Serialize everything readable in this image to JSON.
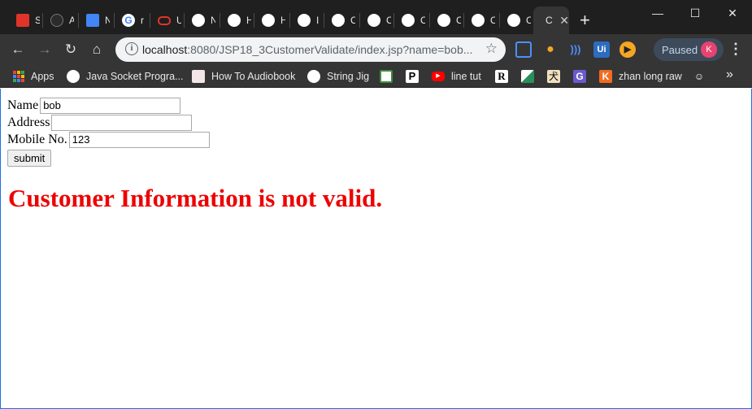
{
  "browser": {
    "tabs": [
      {
        "title": "S",
        "favicon": "acrobat-icon",
        "color": "#e0342b"
      },
      {
        "title": "A",
        "favicon": "github-icon",
        "color": "#2b2b2b"
      },
      {
        "title": "N",
        "favicon": "docs-icon",
        "color": "#4285f4"
      },
      {
        "title": "r",
        "favicon": "google-icon",
        "color": "#ffffff"
      },
      {
        "title": "U",
        "favicon": "oracle-icon",
        "color": "#e0342b"
      },
      {
        "title": "N",
        "favicon": "globe-icon",
        "color": "#ffffff"
      },
      {
        "title": "H",
        "favicon": "globe-icon",
        "color": "#ffffff"
      },
      {
        "title": "H",
        "favicon": "globe-icon",
        "color": "#ffffff"
      },
      {
        "title": "I",
        "favicon": "globe-icon",
        "color": "#ffffff"
      },
      {
        "title": "C",
        "favicon": "globe-icon",
        "color": "#ffffff"
      },
      {
        "title": "C",
        "favicon": "globe-icon",
        "color": "#ffffff"
      },
      {
        "title": "C",
        "favicon": "globe-icon",
        "color": "#ffffff"
      },
      {
        "title": "C",
        "favicon": "globe-icon",
        "color": "#ffffff"
      },
      {
        "title": "C",
        "favicon": "globe-icon",
        "color": "#ffffff"
      },
      {
        "title": "C",
        "favicon": "globe-icon",
        "color": "#ffffff"
      },
      {
        "title": "C",
        "favicon": "none",
        "color": "#353535",
        "active": true
      }
    ],
    "url_host": "localhost",
    "url_rest": ":8080/JSP18_3CustomerValidate/index.jsp?name=bob...",
    "profile_status": "Paused",
    "profile_initial": "K",
    "bookmarks": [
      {
        "label": "Apps",
        "icon": "apps-grid-icon"
      },
      {
        "label": "Java Socket Progra...",
        "icon": "globe-icon"
      },
      {
        "label": "How To Audiobook",
        "icon": "audiobook-icon"
      },
      {
        "label": "String Jig",
        "icon": "globe-icon"
      },
      {
        "label": "",
        "icon": "bookmark-icon"
      },
      {
        "label": "",
        "icon": "p-icon"
      },
      {
        "label": "line tut",
        "icon": "youtube-icon"
      },
      {
        "label": "",
        "icon": "r-icon"
      },
      {
        "label": "",
        "icon": "map-icon"
      },
      {
        "label": "",
        "icon": "kanji-icon"
      },
      {
        "label": "",
        "icon": "g-icon"
      },
      {
        "label": "zhan long raw",
        "icon": "k-icon"
      },
      {
        "label": "",
        "icon": "reddit-icon"
      }
    ]
  },
  "form": {
    "name_label": "Name",
    "name_value": "bob",
    "address_label": "Address",
    "address_value": "",
    "mobile_label": "Mobile No.",
    "mobile_value": "123",
    "submit_label": "submit"
  },
  "message": {
    "text": "Customer Information is not valid.",
    "color": "#ee0000"
  }
}
